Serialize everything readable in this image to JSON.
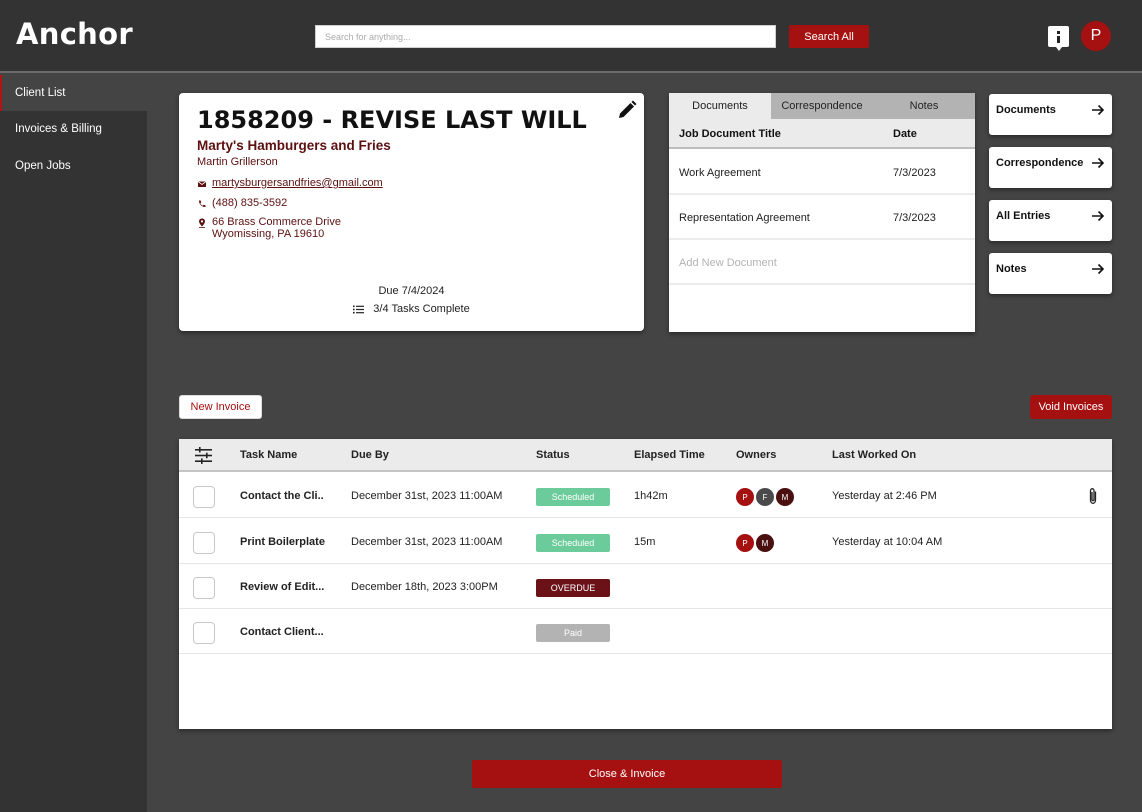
{
  "header": {
    "app_name": "Anchor",
    "search_placeholder": "Search for anything...",
    "search_button": "Search All",
    "info_icon": "info-icon",
    "user_initial": "P"
  },
  "sidebar": {
    "items": [
      {
        "label": "Client List",
        "active": true
      },
      {
        "label": "Invoices & Billing",
        "active": false
      },
      {
        "label": "Open Jobs",
        "active": false
      }
    ]
  },
  "job": {
    "title": "1858209 - REVISE LAST WILL",
    "client": "Marty's Hamburgers and Fries",
    "contact": "Martin Grillerson",
    "email": "martysburgersandfries@gmail.com",
    "phone": "(488) 835-3592",
    "address_line1": "66 Brass Commerce Drive",
    "address_line2": "Wyomissing, PA 19610",
    "due": "Due 7/4/2024",
    "tasks_complete": "3/4 Tasks Complete"
  },
  "documents_panel": {
    "tabs": [
      "Documents",
      "Correspondence",
      "Notes"
    ],
    "active_tab": "Documents",
    "columns": {
      "title": "Job Document Title",
      "date": "Date"
    },
    "rows": [
      {
        "title": "Work Agreement",
        "date": "7/3/2023"
      },
      {
        "title": "Representation Agreement",
        "date": "7/3/2023"
      }
    ],
    "add_label": "Add New Document"
  },
  "quick_links": [
    "Documents",
    "Correspondence",
    "All Entries",
    "Notes"
  ],
  "invoice_actions": {
    "new_invoice": "New Invoice",
    "void_invoices": "Void Invoices"
  },
  "tasks_table": {
    "columns": {
      "task_name": "Task Name",
      "due_by": "Due By",
      "status": "Status",
      "elapsed": "Elapsed Time",
      "owners": "Owners",
      "last_worked": "Last Worked On"
    },
    "rows": [
      {
        "task": "Contact the Cli..",
        "due": "December 31st, 2023 11:00AM",
        "status": "Scheduled",
        "elapsed": "1h42m",
        "owners": [
          "P",
          "F",
          "M"
        ],
        "last_worked": "Yesterday at 2:46 PM",
        "attachment": true
      },
      {
        "task": "Print Boilerplate",
        "due": "December 31st, 2023 11:00AM",
        "status": "Scheduled",
        "elapsed": "15m",
        "owners": [
          "P",
          "M"
        ],
        "last_worked": "Yesterday at 10:04 AM",
        "attachment": false
      },
      {
        "task": "Review of Edit...",
        "due": "December 18th, 2023 3:00PM",
        "status": "OVERDUE",
        "elapsed": "",
        "owners": [],
        "last_worked": "",
        "attachment": false
      },
      {
        "task": "Contact Client...",
        "due": "",
        "status": "Paid",
        "elapsed": "",
        "owners": [],
        "last_worked": "",
        "attachment": false
      }
    ]
  },
  "footer_action": "Close & Invoice",
  "colors": {
    "brand_red": "#a51111",
    "dark_red": "#5c1010",
    "scheduled": "#6ccb9a",
    "overdue": "#6b1219",
    "paid": "#b3b3b3",
    "owner_p": "#a51111",
    "owner_f": "#4a4a4a",
    "owner_m": "#4a0f0f"
  }
}
